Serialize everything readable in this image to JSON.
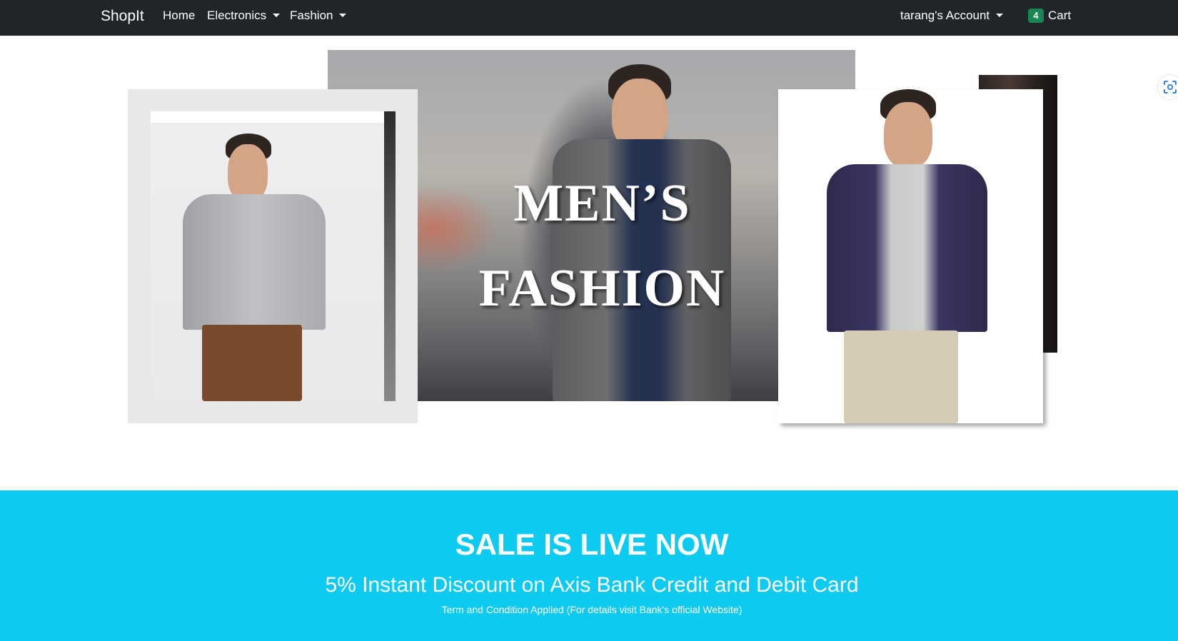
{
  "navbar": {
    "brand": "ShopIt",
    "links": {
      "home": "Home",
      "electronics": "Electronics",
      "fashion": "Fashion"
    },
    "account": "tarang's Account",
    "cart": {
      "count": "4",
      "label": "Cart"
    },
    "background": "#212529",
    "badge_color": "#198754"
  },
  "hero": {
    "title_line1": "MEN’S",
    "title_line2": "FASHION"
  },
  "sale": {
    "title": "SALE IS LIVE NOW",
    "subtitle": "5% Instant Discount on Axis Bank Credit and Debit Card",
    "note": "Term and Condition Applied (For details visit Bank's official Website)",
    "background": "#0dcaf0"
  },
  "icons": {
    "dropdown": "caret-down-icon",
    "scan": "scan-icon"
  }
}
